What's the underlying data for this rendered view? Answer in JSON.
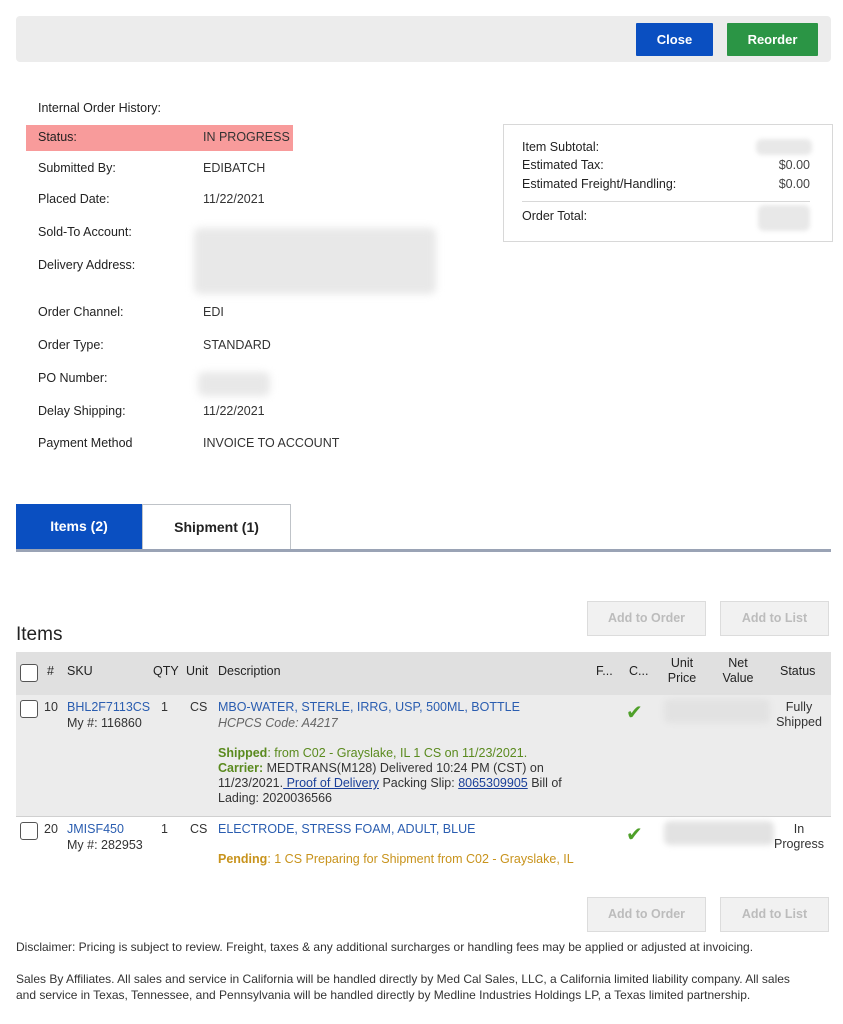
{
  "toolbar": {
    "close_label": "Close",
    "reorder_label": "Reorder"
  },
  "order_info": {
    "header": "Internal Order History:",
    "rows": [
      {
        "label": "Status:",
        "value": "IN PROGRESS"
      },
      {
        "label": "Submitted By:",
        "value": "EDIBATCH"
      },
      {
        "label": "Placed Date:",
        "value": "11/22/2021"
      },
      {
        "label": "Sold-To Account:",
        "value": ""
      },
      {
        "label": "Delivery Address:",
        "value": ""
      },
      {
        "label": "Order Channel:",
        "value": "EDI"
      },
      {
        "label": "Order Type:",
        "value": "STANDARD"
      },
      {
        "label": "PO Number:",
        "value": ""
      },
      {
        "label": "Delay Shipping:",
        "value": "11/22/2021"
      },
      {
        "label": "Payment Method",
        "value": "INVOICE TO ACCOUNT"
      }
    ]
  },
  "summary": {
    "subtotal_label": "Item Subtotal:",
    "tax_label": "Estimated Tax:",
    "tax_value": "$0.00",
    "freight_label": "Estimated Freight/Handling:",
    "freight_value": "$0.00",
    "total_label": "Order Total:"
  },
  "tabs": [
    {
      "label": "Items (2)",
      "active": true
    },
    {
      "label": "Shipment (1)",
      "active": false
    }
  ],
  "items_section": {
    "title": "Items",
    "add_to_order": "Add to Order",
    "add_to_list": "Add to List",
    "columns": [
      "#",
      "SKU",
      "QTY",
      "Unit",
      "Description",
      "F...",
      "C...",
      "Unit Price",
      "Net Value",
      "Status"
    ],
    "unit_price_lines": [
      "Unit",
      "Price"
    ],
    "net_value_lines": [
      "Net",
      "Value"
    ],
    "rows": [
      {
        "line": "10",
        "sku": "BHL2F7113CS",
        "my_number": "My #: 116860",
        "qty": "1",
        "unit": "CS",
        "description": "MBO-WATER, STERLE, IRRG, USP, 500ML, BOTTLE",
        "hcpcs": "HCPCS Code: A4217",
        "shipped_label": "Shipped",
        "shipped_text": ": from C02 - Grayslake, IL 1 CS on 11/23/2021.",
        "carrier_label": "Carrier:",
        "carrier_text": " MEDTRANS(M128) Delivered 10:24 PM (CST) on",
        "carrier_date": "11/23/2021.",
        "proof_link": " Proof of Delivery",
        "packing_label": " Packing Slip: ",
        "packing_link": "8065309905",
        "bill_label": " Bill of",
        "bill_text": "Lading: 2020036566",
        "status_lines": [
          "Fully",
          "Shipped"
        ]
      },
      {
        "line": "20",
        "sku": "JMISF450",
        "my_number": "My #: 282953",
        "qty": "1",
        "unit": "CS",
        "description": "ELECTRODE, STRESS FOAM, ADULT, BLUE",
        "pending_label": "Pending",
        "pending_text": ": 1 CS Preparing for Shipment from C02 - Grayslake, IL",
        "status_lines": [
          "In",
          "Progress"
        ]
      }
    ]
  },
  "disclaimer": "Disclaimer: Pricing is subject to review. Freight, taxes & any additional surcharges or handling fees may be applied or adjusted at invoicing.",
  "affiliates_lines": [
    "Sales By Affiliates. All sales and service in California will be handled directly by Med Cal Sales, LLC, a California limited liability company. All sales",
    "and service in Texas, Tennessee, and Pennsylvania will be handled directly by Medline Industries Holdings LP, a Texas limited partnership."
  ],
  "colors": {
    "primary_blue": "#0a4fc1",
    "reorder_green": "#2b9545",
    "status_highlight": "#f89b9b",
    "shipped_green": "#5a8a1e",
    "pending_gold": "#c8931c"
  }
}
